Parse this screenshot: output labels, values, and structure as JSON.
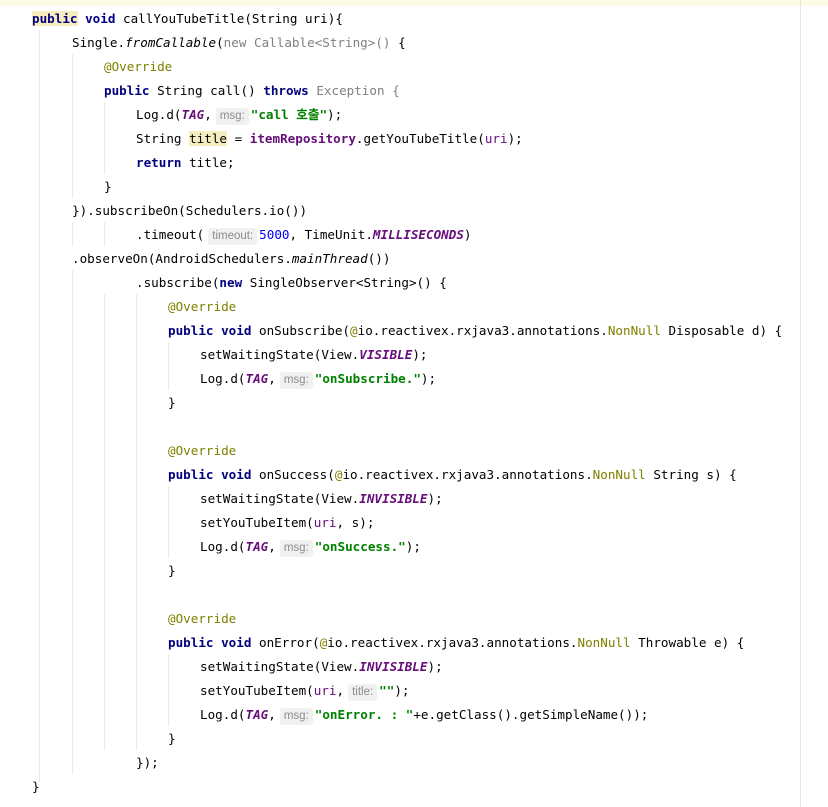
{
  "editor": {
    "params": {
      "msg": "msg:",
      "timeout": "timeout:",
      "title": "title:"
    },
    "code": {
      "l1_kw1": "public",
      "l1_kw2": "void",
      "l1_rest": " callYouTubeTitle(String uri){",
      "l2_a": "Single.",
      "l2_b": "fromCallable",
      "l2_c": "(",
      "l2_new": "new",
      "l2_d": " Callable<String>()",
      "l2_e": " {",
      "l3_ann": "@Override",
      "l4_kw1": "public",
      "l4_a": " String call() ",
      "l4_kw2": "throws",
      "l4_b": " Exception {",
      "l5_a": "Log.d(",
      "l5_tag": "TAG",
      "l5_b": ",",
      "l5_str_a": "\"call ",
      "l5_str_ko": "호출",
      "l5_str_b": "\"",
      "l5_c": ");",
      "l6_a": "String ",
      "l6_var": "title",
      "l6_b": " = ",
      "l6_repo": "itemRepository",
      "l6_c": ".getYouTubeTitle(",
      "l6_arg": "uri",
      "l6_d": ");",
      "l7_kw": "return",
      "l7_a": " title;",
      "l8": "}",
      "l9": "}).subscribeOn(Schedulers.io())",
      "l10_a": ".timeout(",
      "l10_num": "5000",
      "l10_b": ", TimeUnit.",
      "l10_cst": "MILLISECONDS",
      "l10_c": ")",
      "l11_a": ".observeOn(AndroidSchedulers.",
      "l11_b": "mainThread",
      "l11_c": "())",
      "l12_a": ".subscribe(",
      "l12_new": "new",
      "l12_b": " SingleObserver<String>() {",
      "ann": "@Override",
      "l14_kw1": "public",
      "l14_kw2": "void",
      "l14_a": " onSubscribe(",
      "pkg": "io.reactivex.rxjava3.annotations.",
      "nonnull": "NonNull",
      "l14_b": " Disposable d) {",
      "l15_a": "setWaitingState(View.",
      "visible": "VISIBLE",
      "close_call": ");",
      "log": "Log.d(",
      "tag": "TAG",
      "comma": ",",
      "l16_str": "\"onSubscribe.\"",
      "brace": "}",
      "l19_kw1": "public",
      "l19_kw2": "void",
      "l19_a": " onSuccess(",
      "l19_b": " String s) {",
      "l20_a": "setWaitingState(View.",
      "invisible": "INVISIBLE",
      "l21_a": "setYouTubeItem(",
      "l21_uri": "uri",
      "l21_b": ", s);",
      "l22_str": "\"onSuccess.\"",
      "l26_kw1": "public",
      "l26_kw2": "void",
      "l26_a": " onError(",
      "l26_b": " Throwable e) {",
      "l27_a": "setWaitingState(View.",
      "l28_a": "setYouTubeItem(",
      "l28_uri": "uri",
      "l28_b": ",",
      "l28_str": "\"\"",
      "l29_str": "\"onError. : \"",
      "l29_b": "+e.getClass().getSimpleName());",
      "l31": "});",
      "l32": "}"
    }
  }
}
